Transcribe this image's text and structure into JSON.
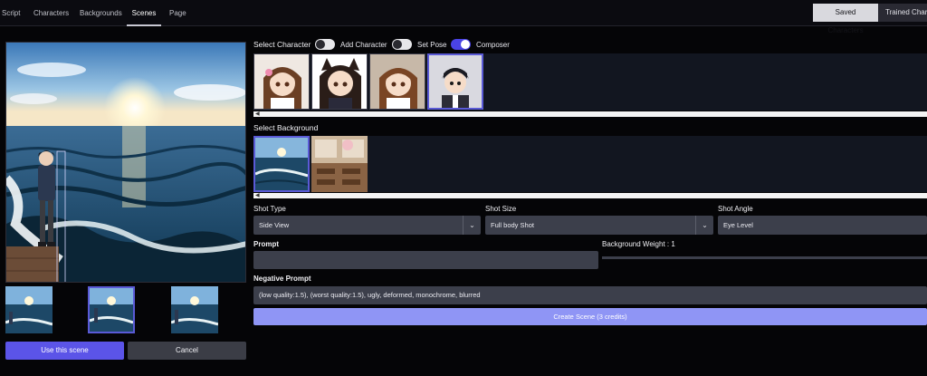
{
  "nav": {
    "tabs": [
      "Script",
      "Characters",
      "Backgrounds",
      "Scenes",
      "Page"
    ],
    "active_tab": "Scenes",
    "saved_characters": "Saved Characters",
    "trained_characters": "Trained Characters"
  },
  "preview": {
    "use_label": "Use this scene",
    "cancel_label": "Cancel",
    "selected_thumb_index": 1
  },
  "character": {
    "title": "Select Character",
    "toggles": [
      {
        "label": "Add Character",
        "on": false
      },
      {
        "label": "Set Pose",
        "on": false
      },
      {
        "label": "Composer",
        "on": true
      }
    ],
    "selected_index": 3
  },
  "background": {
    "title": "Select Background",
    "selected_index": 0
  },
  "shot": {
    "type_label": "Shot Type",
    "type_value": "Side View",
    "size_label": "Shot Size",
    "size_value": "Full body Shot",
    "angle_label": "Shot Angle",
    "angle_value": "Eye Level"
  },
  "prompt": {
    "label": "Prompt",
    "value": "",
    "weight_label": "Background Weight : 1",
    "negative_label": "Negative Prompt",
    "negative_value": "(low quality:1.5), (worst quality:1.5), ugly, deformed, monochrome, blurred"
  },
  "create_label": "Create Scene (3 credits)",
  "colors": {
    "accent": "#5b54e8",
    "create_button": "#8f95f5",
    "field_bg": "#3c3f4b",
    "page_bg": "#050507"
  }
}
